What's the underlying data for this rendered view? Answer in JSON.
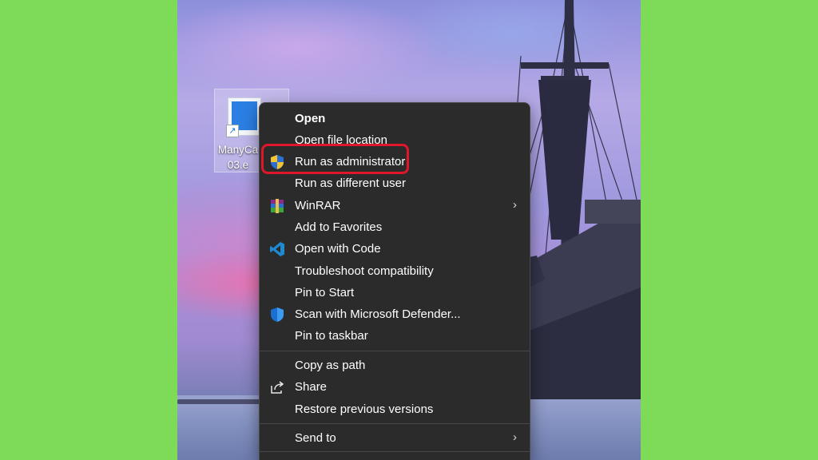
{
  "desktop": {
    "file_icon": {
      "name": "ManyCam 8.0.2.03.exe",
      "name_line1": "ManyCa",
      "name_line2": "03.e"
    }
  },
  "context_menu": {
    "items": [
      {
        "label": "Open",
        "bold": true,
        "icon": "none"
      },
      {
        "label": "Open file location",
        "icon": "none"
      },
      {
        "label": "Run as administrator",
        "icon": "uac-shield-icon",
        "highlighted": true
      },
      {
        "label": "Run as different user",
        "icon": "none"
      },
      {
        "label": "WinRAR",
        "icon": "winrar-icon",
        "submenu": true
      },
      {
        "label": "Add to Favorites",
        "icon": "none"
      },
      {
        "label": "Open with Code",
        "icon": "vscode-icon"
      },
      {
        "label": "Troubleshoot compatibility",
        "icon": "none"
      },
      {
        "label": "Pin to Start",
        "icon": "none"
      },
      {
        "label": "Scan with Microsoft Defender...",
        "icon": "defender-shield-icon"
      },
      {
        "label": "Pin to taskbar",
        "icon": "none"
      },
      {
        "label": "Copy as path",
        "icon": "none"
      },
      {
        "label": "Share",
        "icon": "share-icon"
      },
      {
        "label": "Restore previous versions",
        "icon": "none"
      },
      {
        "label": "Send to",
        "icon": "none",
        "submenu": true
      }
    ],
    "submenu_chevron": "›",
    "highlight_color": "#e0162b",
    "background_color": "#2b2b2b"
  },
  "colors": {
    "frame_background": "#7ddb58"
  }
}
